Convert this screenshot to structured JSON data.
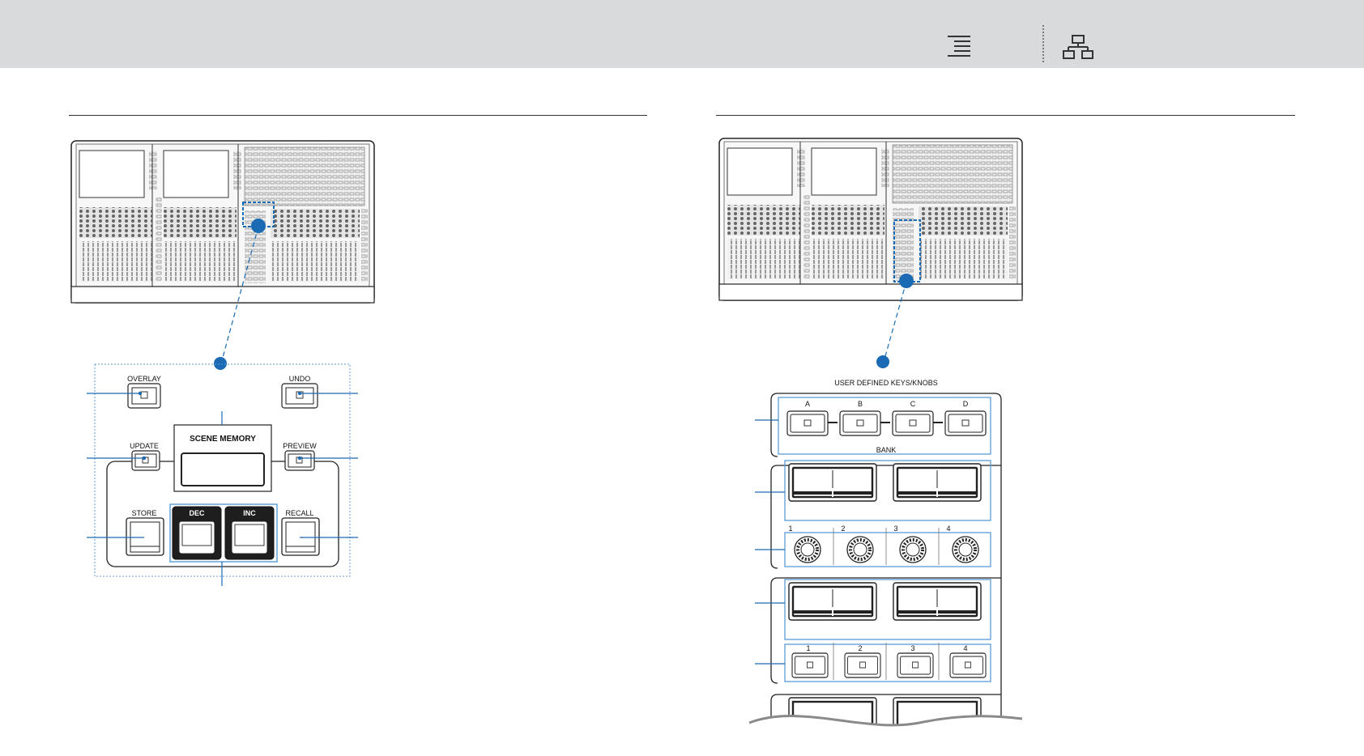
{
  "header": {
    "toc_icon": "toc-list-icon",
    "tree_icon": "sitemap-icon"
  },
  "figure_left": {
    "labels": {
      "overlay": "OVERLAY",
      "undo": "UNDO",
      "update": "UPDATE",
      "scene_memory": "SCENE  MEMORY",
      "preview": "PREVIEW",
      "store": "STORE",
      "dec": "DEC",
      "inc": "INC",
      "recall": "RECALL"
    }
  },
  "figure_right": {
    "labels": {
      "title": "USER  DEFINED  KEYS/KNOBS",
      "bank": "BANK",
      "bank_keys": [
        "A",
        "B",
        "C",
        "D"
      ],
      "knobs": [
        "1",
        "2",
        "3",
        "4"
      ],
      "keys": [
        "1",
        "2",
        "3",
        "4"
      ]
    }
  },
  "colors": {
    "accent": "#1a6bb3",
    "topbar": "#d9dadb"
  }
}
